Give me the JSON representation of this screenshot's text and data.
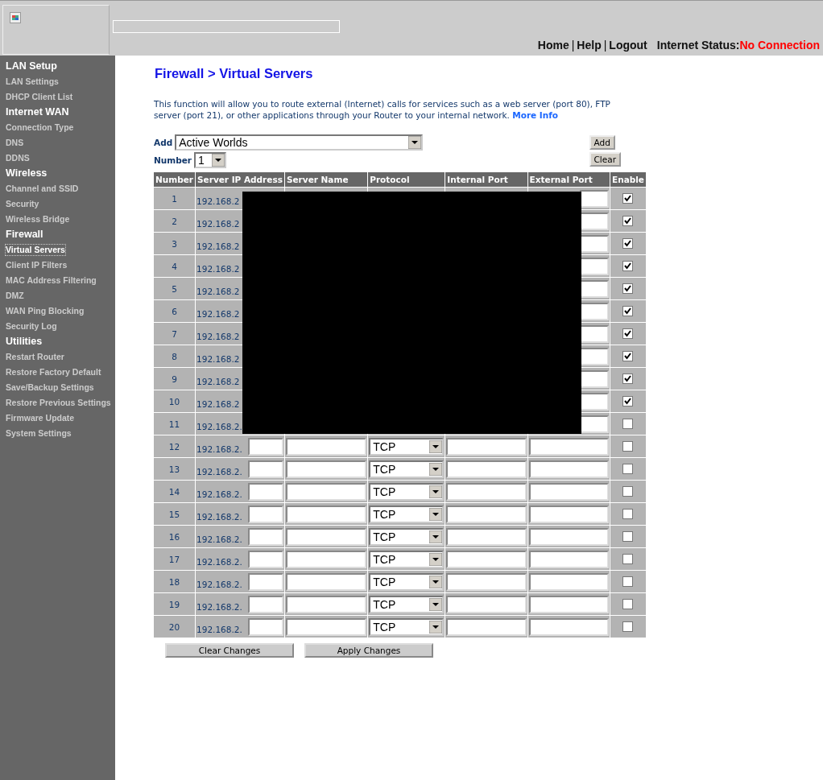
{
  "header": {
    "links": [
      "Home",
      "Help",
      "Logout"
    ],
    "separator": "|",
    "status_label": "Internet Status:",
    "status_value": "No Connection"
  },
  "sidebar": {
    "sections": [
      {
        "title": "LAN Setup",
        "items": [
          {
            "label": "LAN Settings",
            "selected": false
          },
          {
            "label": "DHCP Client List",
            "selected": false
          }
        ]
      },
      {
        "title": "Internet WAN",
        "items": [
          {
            "label": "Connection Type",
            "selected": false
          },
          {
            "label": "DNS",
            "selected": false
          },
          {
            "label": "DDNS",
            "selected": false
          }
        ]
      },
      {
        "title": "Wireless",
        "items": [
          {
            "label": "Channel and SSID",
            "selected": false
          },
          {
            "label": "Security",
            "selected": false
          },
          {
            "label": "Wireless Bridge",
            "selected": false
          }
        ]
      },
      {
        "title": "Firewall",
        "items": [
          {
            "label": "Virtual Servers",
            "selected": true
          },
          {
            "label": "Client IP Filters",
            "selected": false
          },
          {
            "label": "MAC Address Filtering",
            "selected": false
          },
          {
            "label": "DMZ",
            "selected": false
          },
          {
            "label": "WAN Ping Blocking",
            "selected": false
          },
          {
            "label": "Security Log",
            "selected": false
          }
        ]
      },
      {
        "title": "Utilities",
        "items": [
          {
            "label": "Restart Router",
            "selected": false
          },
          {
            "label": "Restore Factory Default",
            "selected": false
          },
          {
            "label": "Save/Backup Settings",
            "selected": false
          },
          {
            "label": "Restore Previous Settings",
            "selected": false
          },
          {
            "label": "Firmware Update",
            "selected": false
          },
          {
            "label": "System Settings",
            "selected": false
          }
        ]
      }
    ]
  },
  "page": {
    "title": "Firewall > Virtual Servers",
    "description": "This function will allow you to route external (Internet) calls for services such as a web server (port 80), FTP server (port 21), or other applications through your Router to your internal network.",
    "more_info": "More Info",
    "add_label": "Add",
    "add_select": "Active Worlds",
    "number_label": "Number",
    "number_select": "1",
    "add_button": "Add",
    "clear_button": "Clear"
  },
  "table": {
    "columns": [
      "Number",
      "Server IP Address",
      "Server Name",
      "Protocol",
      "Internal Port",
      "External Port",
      "Enable"
    ],
    "rows": [
      {
        "number": "1",
        "ip_prefix": "192.168.2",
        "covered": true,
        "enabled": true
      },
      {
        "number": "2",
        "ip_prefix": "192.168.2",
        "covered": true,
        "enabled": true
      },
      {
        "number": "3",
        "ip_prefix": "192.168.2",
        "covered": true,
        "enabled": true
      },
      {
        "number": "4",
        "ip_prefix": "192.168.2",
        "covered": true,
        "enabled": true
      },
      {
        "number": "5",
        "ip_prefix": "192.168.2",
        "covered": true,
        "enabled": true
      },
      {
        "number": "6",
        "ip_prefix": "192.168.2",
        "covered": true,
        "enabled": true
      },
      {
        "number": "7",
        "ip_prefix": "192.168.2",
        "covered": true,
        "enabled": true
      },
      {
        "number": "8",
        "ip_prefix": "192.168.2",
        "covered": true,
        "enabled": true
      },
      {
        "number": "9",
        "ip_prefix": "192.168.2",
        "covered": true,
        "enabled": true
      },
      {
        "number": "10",
        "ip_prefix": "192.168.2",
        "covered": true,
        "enabled": true
      },
      {
        "number": "11",
        "ip_prefix": "192.168.2.",
        "covered": true,
        "enabled": false
      },
      {
        "number": "12",
        "ip_prefix": "192.168.2.",
        "covered": false,
        "protocol": "TCP",
        "enabled": false
      },
      {
        "number": "13",
        "ip_prefix": "192.168.2.",
        "covered": false,
        "protocol": "TCP",
        "enabled": false
      },
      {
        "number": "14",
        "ip_prefix": "192.168.2.",
        "covered": false,
        "protocol": "TCP",
        "enabled": false
      },
      {
        "number": "15",
        "ip_prefix": "192.168.2.",
        "covered": false,
        "protocol": "TCP",
        "enabled": false
      },
      {
        "number": "16",
        "ip_prefix": "192.168.2.",
        "covered": false,
        "protocol": "TCP",
        "enabled": false
      },
      {
        "number": "17",
        "ip_prefix": "192.168.2.",
        "covered": false,
        "protocol": "TCP",
        "enabled": false
      },
      {
        "number": "18",
        "ip_prefix": "192.168.2.",
        "covered": false,
        "protocol": "TCP",
        "enabled": false
      },
      {
        "number": "19",
        "ip_prefix": "192.168.2.",
        "covered": false,
        "protocol": "TCP",
        "enabled": false
      },
      {
        "number": "20",
        "ip_prefix": "192.168.2.",
        "covered": false,
        "protocol": "TCP",
        "enabled": false
      }
    ]
  },
  "buttons": [
    "Clear Changes",
    "Apply Changes"
  ]
}
